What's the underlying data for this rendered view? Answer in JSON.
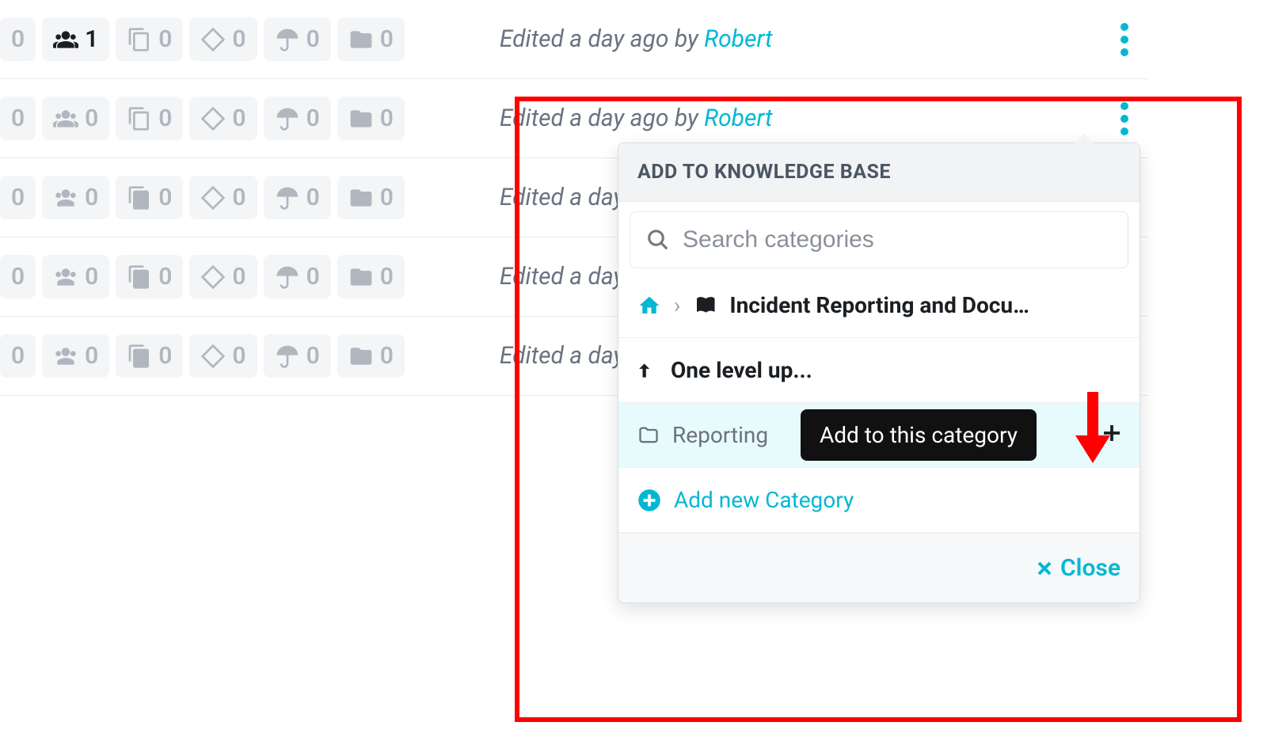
{
  "colors": {
    "accent": "#00b8d4",
    "muted": "#b0b7bf",
    "highlight_border": "#ff0000"
  },
  "rows": [
    {
      "badges": {
        "views": "0",
        "users": "1",
        "copies": "0",
        "checks": "0",
        "umbrella": "0",
        "folder": "0",
        "users_active": true
      },
      "edited_prefix": "Edited a day ago by ",
      "author": "Robert"
    },
    {
      "badges": {
        "views": "0",
        "users": "0",
        "copies": "0",
        "checks": "0",
        "umbrella": "0",
        "folder": "0",
        "users_active": false
      },
      "edited_prefix": "Edited a day ago by ",
      "author": "Robert"
    },
    {
      "badges": {
        "views": "0",
        "users": "0",
        "copies": "0",
        "checks": "0",
        "umbrella": "0",
        "folder": "0",
        "users_active": false
      },
      "edited_prefix": "Edited a day ag",
      "author": ""
    },
    {
      "badges": {
        "views": "0",
        "users": "0",
        "copies": "0",
        "checks": "0",
        "umbrella": "0",
        "folder": "0",
        "users_active": false
      },
      "edited_prefix": "Edited a day ag",
      "author": ""
    },
    {
      "badges": {
        "views": "0",
        "users": "0",
        "copies": "0",
        "checks": "0",
        "umbrella": "0",
        "folder": "0",
        "users_active": false
      },
      "edited_prefix": "Edited a day ag",
      "author": ""
    }
  ],
  "popover": {
    "title": "ADD TO KNOWLEDGE BASE",
    "search_placeholder": "Search categories",
    "breadcrumb": "Incident Reporting and Docu…",
    "level_up": "One level up...",
    "folder_name": "Reporting",
    "tooltip": "Add to this category",
    "add_new": "Add new Category",
    "close": "Close"
  }
}
